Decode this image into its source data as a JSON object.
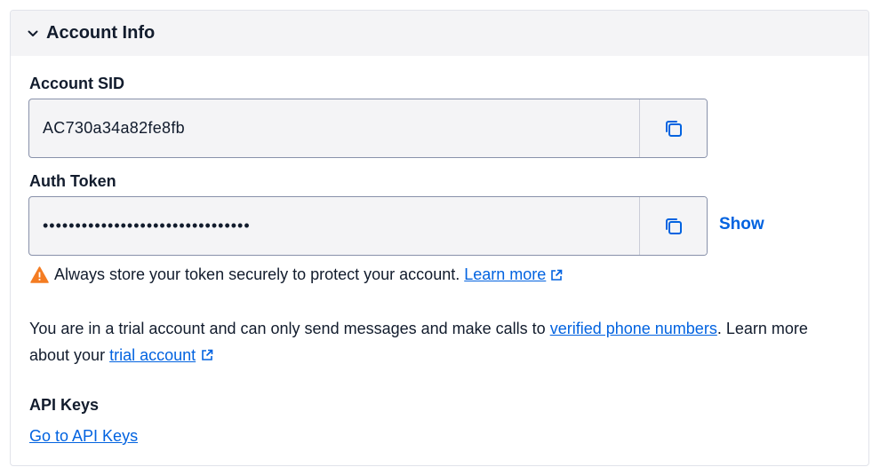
{
  "panel": {
    "title": "Account Info"
  },
  "account_sid": {
    "label": "Account SID",
    "value": "AC730a34a82fe8fb"
  },
  "auth_token": {
    "label": "Auth Token",
    "value": "••••••••••••••••••••••••••••••••",
    "show_label": "Show"
  },
  "warning": {
    "text": "Always store your token securely to protect your account.",
    "link": "Learn more"
  },
  "trial": {
    "text_before": "You are in a trial account and can only send messages and make calls to",
    "verified_link": "verified phone numbers",
    "text_middle": ". Learn more about your",
    "trial_link": "trial account"
  },
  "api_keys": {
    "label": "API Keys",
    "link": "Go to API Keys"
  },
  "colors": {
    "link": "#0263e0",
    "warning": "#f47c22",
    "text": "#121c2d"
  }
}
